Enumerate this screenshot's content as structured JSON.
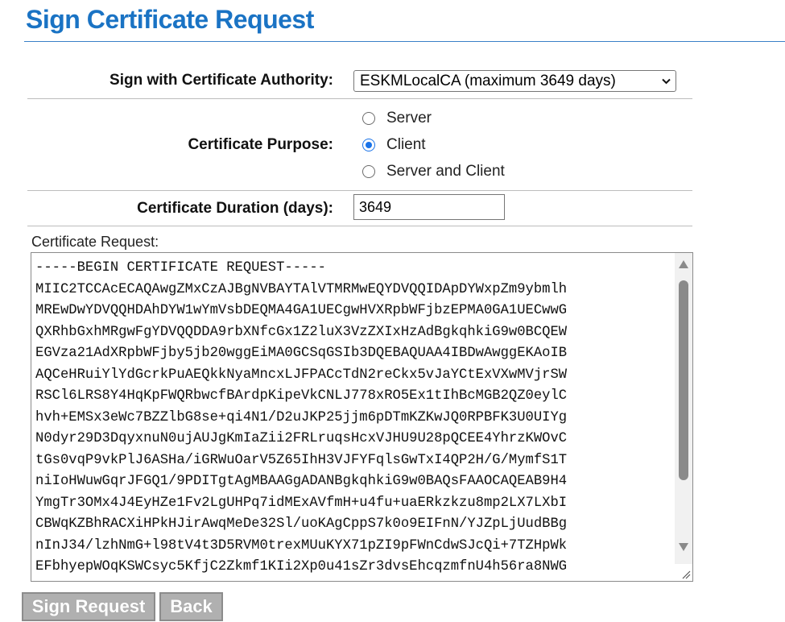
{
  "page": {
    "title": "Sign Certificate Request"
  },
  "form": {
    "ca_label": "Sign with Certificate Authority:",
    "ca_selected": "ESKMLocalCA (maximum 3649 days)",
    "purpose_label": "Certificate Purpose:",
    "purpose_options": [
      {
        "label": "Server",
        "checked": false
      },
      {
        "label": "Client",
        "checked": true
      },
      {
        "label": "Server and Client",
        "checked": false
      }
    ],
    "duration_label": "Certificate Duration (days):",
    "duration_value": "3649",
    "request_label": "Certificate Request:",
    "request_text": "-----BEGIN CERTIFICATE REQUEST-----\nMIIC2TCCAcECAQAwgZMxCzAJBgNVBAYTAlVTMRMwEQYDVQQIDApDYWxpZm9ybmlh\nMREwDwYDVQQHDAhDYW1wYmVsbDEQMA4GA1UECgwHVXRpbWFjbzEPMA0GA1UECwwG\nQXRhbGxhMRgwFgYDVQQDDA9rbXNfcGx1Z2luX3VzZXIxHzAdBgkqhkiG9w0BCQEW\nEGVza21AdXRpbWFjby5jb20wggEiMA0GCSqGSIb3DQEBAQUAA4IBDwAwggEKAoIB\nAQCeHRuiYlYdGcrkPuAEQkkNyaMncxLJFPACcTdN2reCkx5vJaYCtExVXwMVjrSW\nRSCl6LRS8Y4HqKpFWQRbwcfBArdpKipeVkCNLJ778xRO5Ex1tIhBcMGB2QZ0eylC\nhvh+EMSx3eWc7BZZlbG8se+qi4N1/D2uJKP25jjm6pDTmKZKwJQ0RPBFK3U0UIYg\nN0dyr29D3DqyxnuN0ujAUJgKmIaZii2FRLruqsHcxVJHU9U28pQCEE4YhrzKWOvC\ntGs0vqP9vkPlJ6ASHa/iGRWuOarV5Z65IhH3VJFYFqlsGwTxI4QP2H/G/MymfS1T\nniIoHWuwGqrJFGQ1/9PDITgtAgMBAAGgADANBgkqhkiG9w0BAQsFAAOCAQEAB9H4\nYmgTr3OMx4J4EyHZe1Fv2LgUHPq7idMExAVfmH+u4fu+uaERkzkzu8mp2LX7LXbI\nCBWqKZBhRACXiHPkHJirAwqMeDe32Sl/uoKAgCppS7k0o9EIFnN/YJZpLjUudBBg\nnInJ34/lzhNmG+l98tV4t3D5RVM0trexMUuKYX71pZI9pFWnCdwSJcQi+7TZHpWk\nEFbhyepWOqKSWCsyc5KfjC2Zkmf1KIi2Xp0u41sZr3dvsEhcqzmfnU4h56ra8NWG"
  },
  "buttons": {
    "sign": "Sign Request",
    "back": "Back"
  },
  "colors": {
    "title": "#1a73c4",
    "radio_accent": "#1a73e8",
    "button_disabled": "#b0b0b0"
  }
}
